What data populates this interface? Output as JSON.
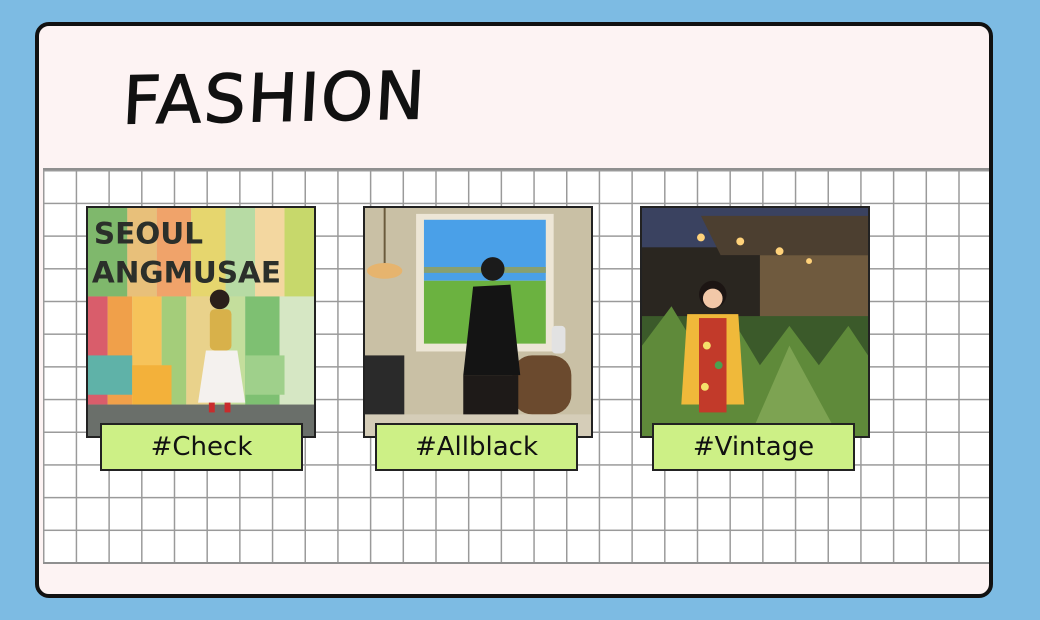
{
  "title": "FASHION",
  "cards": [
    {
      "tag": "#Check",
      "photo_icon": "wall-photo-icon",
      "sign_line1": "SEOUL",
      "sign_line2": "ANGMUSAE"
    },
    {
      "tag": "#Allblack",
      "photo_icon": "window-photo-icon"
    },
    {
      "tag": "#Vintage",
      "photo_icon": "garden-photo-icon"
    }
  ],
  "colors": {
    "page_bg": "#7dbbe3",
    "frame_bg": "#fdf3f3",
    "tag_bg": "#cdf086",
    "grid_line": "#9a9a9a"
  }
}
